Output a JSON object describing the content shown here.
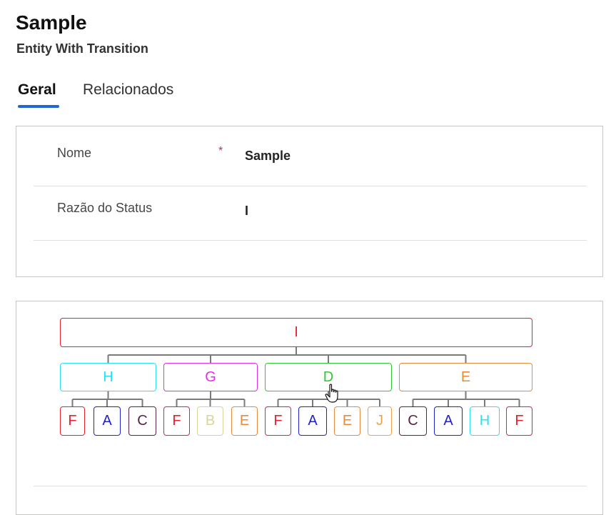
{
  "header": {
    "title": "Sample",
    "subtitle": "Entity With Transition"
  },
  "tabs": [
    {
      "label": "Geral",
      "active": true
    },
    {
      "label": "Relacionados",
      "active": false
    }
  ],
  "form": {
    "fields": [
      {
        "label": "Nome",
        "required": true,
        "required_mark": "*",
        "value": "Sample"
      },
      {
        "label": "Razão do Status",
        "required": false,
        "value": "I"
      }
    ]
  },
  "tree": {
    "root": {
      "label": "I",
      "color": "#e8212f"
    },
    "groups": [
      {
        "label": "H",
        "color": "#29e0f0",
        "children": [
          {
            "label": "F",
            "color": "#e8212f"
          },
          {
            "label": "A",
            "color": "#2222cc"
          },
          {
            "label": "C",
            "color": "#5a2348"
          }
        ]
      },
      {
        "label": "G",
        "color": "#e030e8",
        "children": [
          {
            "label": "F",
            "color": "#e8212f"
          },
          {
            "label": "B",
            "color": "#d8d59a"
          },
          {
            "label": "E",
            "color": "#e88a3a"
          }
        ]
      },
      {
        "label": "D",
        "color": "#2ec833",
        "children": [
          {
            "label": "F",
            "color": "#e8212f"
          },
          {
            "label": "A",
            "color": "#2222cc"
          },
          {
            "label": "E",
            "color": "#e88a3a"
          },
          {
            "label": "J",
            "color": "#f0a14a"
          }
        ]
      },
      {
        "label": "E",
        "color": "#e88a3a",
        "children": [
          {
            "label": "C",
            "color": "#5a2348"
          },
          {
            "label": "A",
            "color": "#2222cc"
          },
          {
            "label": "H",
            "color": "#29e0f0"
          },
          {
            "label": "F",
            "color": "#e8212f"
          }
        ]
      }
    ]
  },
  "colors": {
    "accent": "#2266d6",
    "connector": "#7a7a7a",
    "card_border": "#c8c6c4"
  }
}
